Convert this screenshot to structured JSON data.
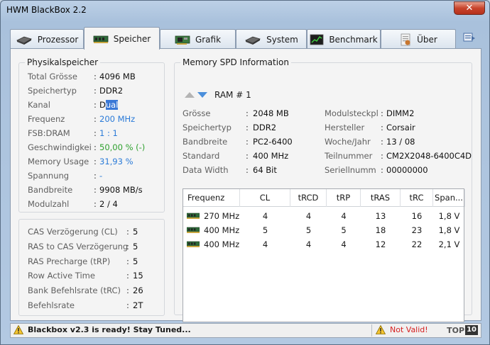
{
  "window": {
    "title": "HWM BlackBox 2.2",
    "close_glyph": "✕"
  },
  "tabs": [
    {
      "label": "Prozessor",
      "icon": "cpu-icon"
    },
    {
      "label": "Speicher",
      "icon": "ram-icon"
    },
    {
      "label": "Grafik",
      "icon": "graphics-card-icon"
    },
    {
      "label": "System",
      "icon": "system-icon"
    },
    {
      "label": "Benchmark",
      "icon": "benchmark-icon"
    },
    {
      "label": "Über",
      "icon": "about-icon"
    }
  ],
  "physical": {
    "title": "Physikalspeicher",
    "rows": [
      {
        "label": "Total Grösse",
        "sep": ":",
        "value": "4096 MB"
      },
      {
        "label": "Speichertyp",
        "sep": ":",
        "value": "DDR2"
      },
      {
        "label": "Kanal",
        "sep": ":",
        "value_pre": "D",
        "value_sel": "ual"
      },
      {
        "label": "Frequenz",
        "sep": ":",
        "value": "200 MHz"
      },
      {
        "label": "FSB:DRAM",
        "sep": ":",
        "value": "1 : 1"
      },
      {
        "label": "Geschwindigkei",
        "sep": ":",
        "value": "50,00 % (-)"
      },
      {
        "label": "Memory Usage",
        "sep": ":",
        "value": "31,93 %"
      },
      {
        "label": "Spannung",
        "sep": ":",
        "value": "-"
      },
      {
        "label": "Bandbreite",
        "sep": ":",
        "value": "9908 MB/s"
      },
      {
        "label": "Modulzahl",
        "sep": ":",
        "value": "2  /  4"
      }
    ]
  },
  "timings": {
    "rows": [
      {
        "label": "CAS Verzögerung (CL)",
        "sep": ":",
        "value": "5"
      },
      {
        "label": "RAS to CAS Verzögerung",
        "sep": ":",
        "value": "5"
      },
      {
        "label": "RAS Precharge (tRP)",
        "sep": ":",
        "value": "5"
      },
      {
        "label": "Row Active Time",
        "sep": ":",
        "value": "15"
      },
      {
        "label": "Bank Befehlsrate (tRC)",
        "sep": ":",
        "value": "26"
      },
      {
        "label": "Befehlsrate",
        "sep": ":",
        "value": "2T"
      }
    ]
  },
  "spd": {
    "title": "Memory SPD Information",
    "ram_label": "RAM # 1",
    "left": [
      {
        "label": "Grösse",
        "sep": ":",
        "value": "2048 MB"
      },
      {
        "label": "Speichertyp",
        "sep": ":",
        "value": "DDR2"
      },
      {
        "label": "Bandbreite",
        "sep": ":",
        "value": "PC2-6400"
      },
      {
        "label": "Standard",
        "sep": ":",
        "value": "400 MHz"
      },
      {
        "label": "Data Width",
        "sep": ":",
        "value": "64 Bit"
      }
    ],
    "right": [
      {
        "label": "Modulsteckpl",
        "sep": ":",
        "value": "DIMM2"
      },
      {
        "label": "Hersteller",
        "sep": ":",
        "value": "Corsair"
      },
      {
        "label": "Woche/Jahr",
        "sep": ":",
        "value": "13 / 08"
      },
      {
        "label": "Teilnummer",
        "sep": ":",
        "value": "CM2X2048-6400C4D"
      },
      {
        "label": "Seriellnumm",
        "sep": ":",
        "value": "00000000"
      }
    ],
    "table": {
      "headers": [
        "Frequenz",
        "CL",
        "tRCD",
        "tRP",
        "tRAS",
        "tRC",
        "Span..."
      ],
      "rows": [
        [
          "270 MHz",
          "4",
          "4",
          "4",
          "13",
          "16",
          "1,8 V"
        ],
        [
          "400 MHz",
          "5",
          "5",
          "5",
          "18",
          "23",
          "1,8 V"
        ],
        [
          "400 MHz",
          "4",
          "4",
          "4",
          "12",
          "22",
          "2,1 V"
        ]
      ]
    }
  },
  "status": {
    "message": "Blackbox v2.3 is ready! Stay Tuned...",
    "valid": "Not Valid!",
    "brand_text": "TOP",
    "brand_num": "10"
  }
}
